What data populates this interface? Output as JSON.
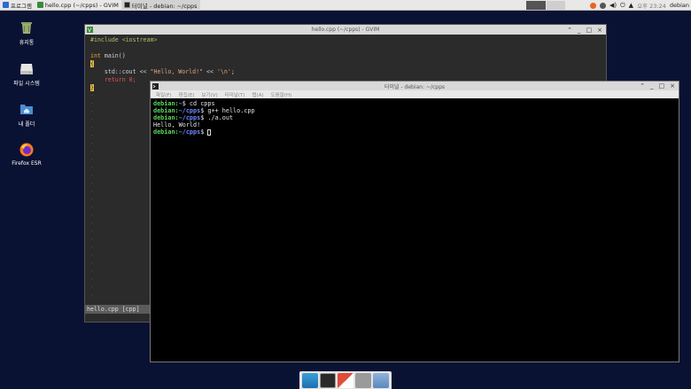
{
  "taskbar": {
    "app_menu": "프로그램",
    "tasks": [
      {
        "label": "hello.cpp (~/cpps) - GVIM",
        "active": false
      },
      {
        "label": "터미널 - debian: ~/cpps",
        "active": true
      }
    ],
    "clock": "오후 23:24",
    "user": "debian"
  },
  "desktop_icons": [
    {
      "label": "휴지통",
      "icon": "trash-icon"
    },
    {
      "label": "파일 시스템",
      "icon": "drive-icon"
    },
    {
      "label": "내 폴더",
      "icon": "home-folder-icon"
    },
    {
      "label": "Firefox ESR",
      "icon": "firefox-icon"
    }
  ],
  "gvim": {
    "title": "hello.cpp (~/cpps) - GVIM",
    "status": "hello.cpp [cpp]",
    "code": {
      "include": "#include <iostream>",
      "main_kw": "int",
      "main_rest": " main()",
      "open_brace": "{",
      "cout_pre": "    std::cout << ",
      "cout_str": "\"Hello, World!\"",
      "cout_mid": " << ",
      "cout_nl": "'\\n'",
      "cout_end": ";",
      "return_line": "    return 0;",
      "close_brace": "}"
    }
  },
  "terminal": {
    "title": "터미널 - debian: ~/cpps",
    "menu": [
      "파일(F)",
      "편집(E)",
      "보기(V)",
      "터미널(T)",
      "탭(A)",
      "도움말(H)"
    ],
    "lines": [
      {
        "host": "debian:",
        "path": "~",
        "cmd": "$ cd cpps"
      },
      {
        "host": "debian:",
        "path": "~/cpps",
        "cmd": "$ g++ hello.cpp"
      },
      {
        "host": "debian:",
        "path": "~/cpps",
        "cmd": "$ ./a.out"
      }
    ],
    "output": "Hello, World!",
    "prompt": {
      "host": "debian:",
      "path": "~/cpps",
      "cmd": "$ "
    }
  },
  "colors": {
    "desktop": "#0a1233",
    "prompt_host": "#5fd75f",
    "prompt_path": "#6f8cff"
  }
}
